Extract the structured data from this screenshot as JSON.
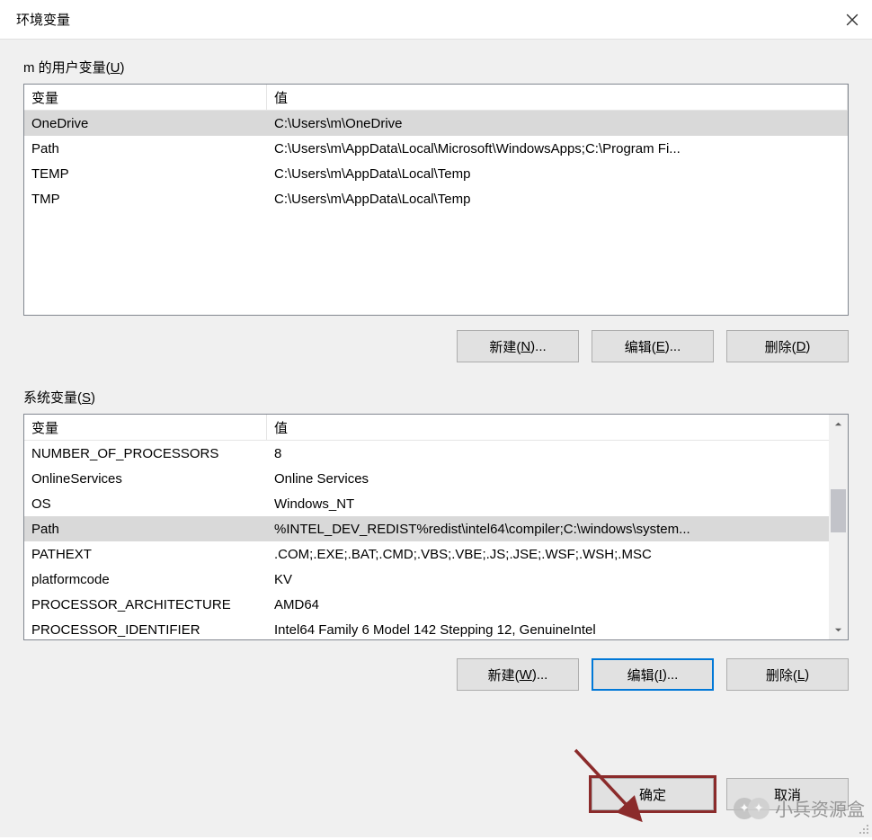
{
  "title": "环境变量",
  "user_vars": {
    "label_prefix": "m 的用户变量(",
    "label_mn": "U",
    "label_suffix": ")",
    "headers": {
      "var": "变量",
      "val": "值"
    },
    "rows": [
      {
        "var": "OneDrive",
        "val": "C:\\Users\\m\\OneDrive",
        "selected": true
      },
      {
        "var": "Path",
        "val": "C:\\Users\\m\\AppData\\Local\\Microsoft\\WindowsApps;C:\\Program Fi...",
        "selected": false
      },
      {
        "var": "TEMP",
        "val": "C:\\Users\\m\\AppData\\Local\\Temp",
        "selected": false
      },
      {
        "var": "TMP",
        "val": "C:\\Users\\m\\AppData\\Local\\Temp",
        "selected": false
      }
    ],
    "buttons": {
      "new": {
        "pre": "新建(",
        "mn": "N",
        "post": ")..."
      },
      "edit": {
        "pre": "编辑(",
        "mn": "E",
        "post": ")..."
      },
      "delete": {
        "pre": "删除(",
        "mn": "D",
        "post": ")"
      }
    }
  },
  "system_vars": {
    "label_prefix": "系统变量(",
    "label_mn": "S",
    "label_suffix": ")",
    "headers": {
      "var": "变量",
      "val": "值"
    },
    "rows": [
      {
        "var": "NUMBER_OF_PROCESSORS",
        "val": "8",
        "selected": false
      },
      {
        "var": "OnlineServices",
        "val": "Online Services",
        "selected": false
      },
      {
        "var": "OS",
        "val": "Windows_NT",
        "selected": false
      },
      {
        "var": "Path",
        "val": "%INTEL_DEV_REDIST%redist\\intel64\\compiler;C:\\windows\\system...",
        "selected": true
      },
      {
        "var": "PATHEXT",
        "val": ".COM;.EXE;.BAT;.CMD;.VBS;.VBE;.JS;.JSE;.WSF;.WSH;.MSC",
        "selected": false
      },
      {
        "var": "platformcode",
        "val": "KV",
        "selected": false
      },
      {
        "var": "PROCESSOR_ARCHITECTURE",
        "val": "AMD64",
        "selected": false
      },
      {
        "var": "PROCESSOR_IDENTIFIER",
        "val": "Intel64 Family 6 Model 142 Stepping 12, GenuineIntel",
        "selected": false
      }
    ],
    "buttons": {
      "new": {
        "pre": "新建(",
        "mn": "W",
        "post": ")..."
      },
      "edit": {
        "pre": "编辑(",
        "mn": "I",
        "post": ")..."
      },
      "delete": {
        "pre": "删除(",
        "mn": "L",
        "post": ")"
      }
    }
  },
  "dialog_buttons": {
    "ok": "确定",
    "cancel": "取消"
  },
  "watermark": "小兵资源盒"
}
